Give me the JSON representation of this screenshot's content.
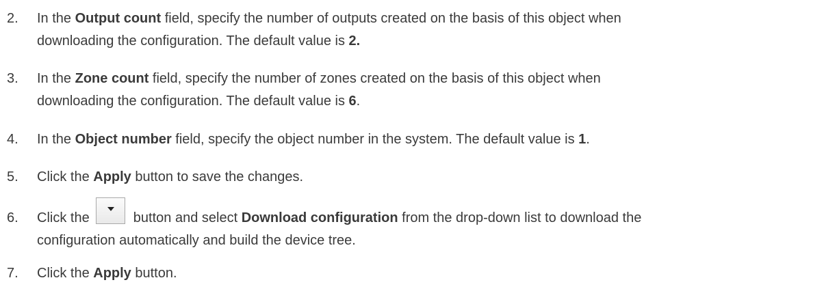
{
  "steps": [
    {
      "num": "2.",
      "pre": "In the ",
      "field": "Output count",
      "mid": " field, specify the number of outputs created on the basis of this object when",
      "line2": "downloading the configuration. The default value is ",
      "value": "2."
    },
    {
      "num": "3.",
      "pre": "In the ",
      "field": "Zone count",
      "mid": " field, specify the number of zones created on the basis of this object when",
      "line2": "downloading the configuration. The default value is ",
      "value": "6",
      "end": "."
    },
    {
      "num": "4.",
      "pre": "In the ",
      "field": "Object number",
      "mid": " field, specify the object number in the system. The default value is ",
      "value": "1",
      "end": "."
    },
    {
      "num": "5.",
      "pre": "Click the ",
      "button": "Apply",
      "post": " button to save the changes."
    },
    {
      "num": "6.",
      "pre": "Click the ",
      "mid": " button and select ",
      "option": "Download configuration",
      "post": " from the drop-down list to download the",
      "line2": "configuration automatically and build the device tree.",
      "icon": "dropdown-arrow-icon"
    },
    {
      "num": "7.",
      "pre": "Click the ",
      "button": "Apply",
      "post": " button."
    }
  ]
}
